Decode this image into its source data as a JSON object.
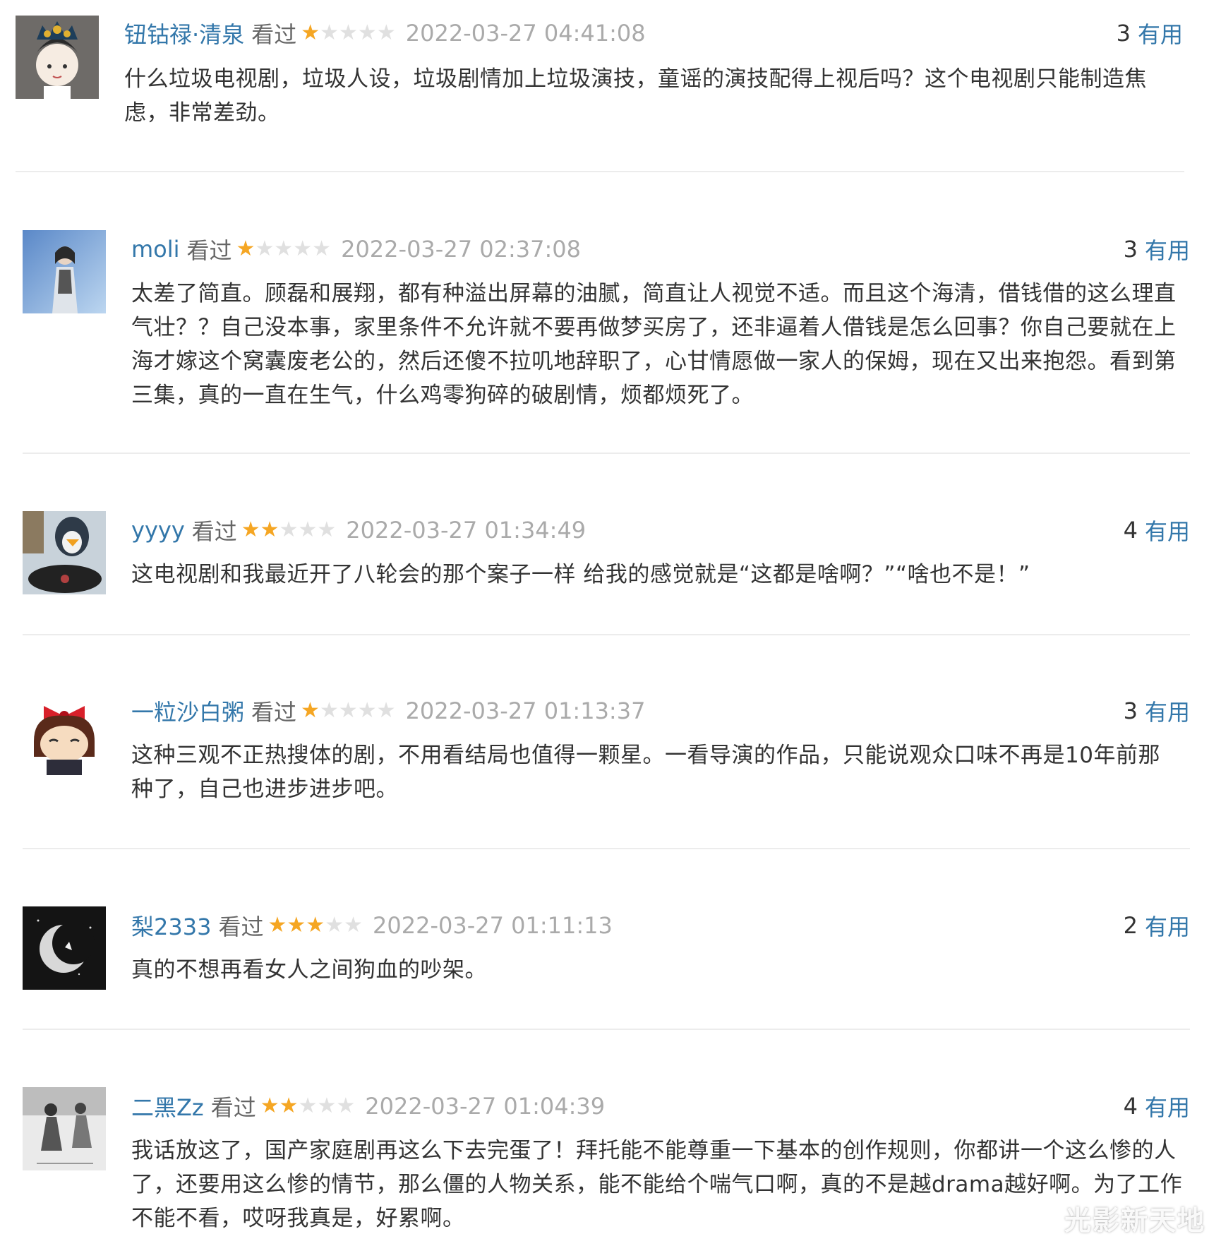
{
  "reviews": [
    {
      "user": "钮钴禄·清泉",
      "status": "看过",
      "rating": 1,
      "time": "2022-03-27 04:41:08",
      "votes": "3",
      "useful_label": "有用",
      "content": "什么垃圾电视剧，垃圾人设，垃圾剧情加上垃圾演技，童谣的演技配得上视后吗？这个电视剧只能制造焦虑，非常差劲。"
    },
    {
      "user": "moli",
      "status": "看过",
      "rating": 1,
      "time": "2022-03-27 02:37:08",
      "votes": "3",
      "useful_label": "有用",
      "content": "太差了简直。顾磊和展翔，都有种溢出屏幕的油腻，简直让人视觉不适。而且这个海清，借钱借的这么理直气壮？？自己没本事，家里条件不允许就不要再做梦买房了，还非逼着人借钱是怎么回事？你自己要就在上海才嫁这个窝囊废老公的，然后还傻不拉叽地辞职了，心甘情愿做一家人的保姆，现在又出来抱怨。看到第三集，真的一直在生气，什么鸡零狗碎的破剧情，烦都烦死了。"
    },
    {
      "user": "yyyy",
      "status": "看过",
      "rating": 2,
      "time": "2022-03-27 01:34:49",
      "votes": "4",
      "useful_label": "有用",
      "content": "这电视剧和我最近开了八轮会的那个案子一样 给我的感觉就是“这都是啥啊？”“啥也不是！”"
    },
    {
      "user": "一粒沙白粥",
      "status": "看过",
      "rating": 1,
      "time": "2022-03-27 01:13:37",
      "votes": "3",
      "useful_label": "有用",
      "content": "这种三观不正热搜体的剧，不用看结局也值得一颗星。一看导演的作品，只能说观众口味不再是10年前那种了，自己也进步进步吧。"
    },
    {
      "user": "梨2333",
      "status": "看过",
      "rating": 3,
      "time": "2022-03-27 01:11:13",
      "votes": "2",
      "useful_label": "有用",
      "content": "真的不想再看女人之间狗血的吵架。"
    },
    {
      "user": "二黑Zz",
      "status": "看过",
      "rating": 2,
      "time": "2022-03-27 01:04:39",
      "votes": "4",
      "useful_label": "有用",
      "content": "我话放这了，国产家庭剧再这么下去完蛋了！拜托能不能尊重一下基本的创作规则，你都讲一个这么惨的人了，还要用这么惨的情节，那么僵的人物关系，能不能给个喘气口啊，真的不是越drama越好啊。为了工作不能不看，哎呀我真是，好累啊。"
    }
  ],
  "watermark": "光影新天地",
  "colors": {
    "link": "#3377aa",
    "star_on": "#f5a623",
    "star_off": "#e0e0e0",
    "time": "#aaaaaa",
    "text": "#333333"
  }
}
